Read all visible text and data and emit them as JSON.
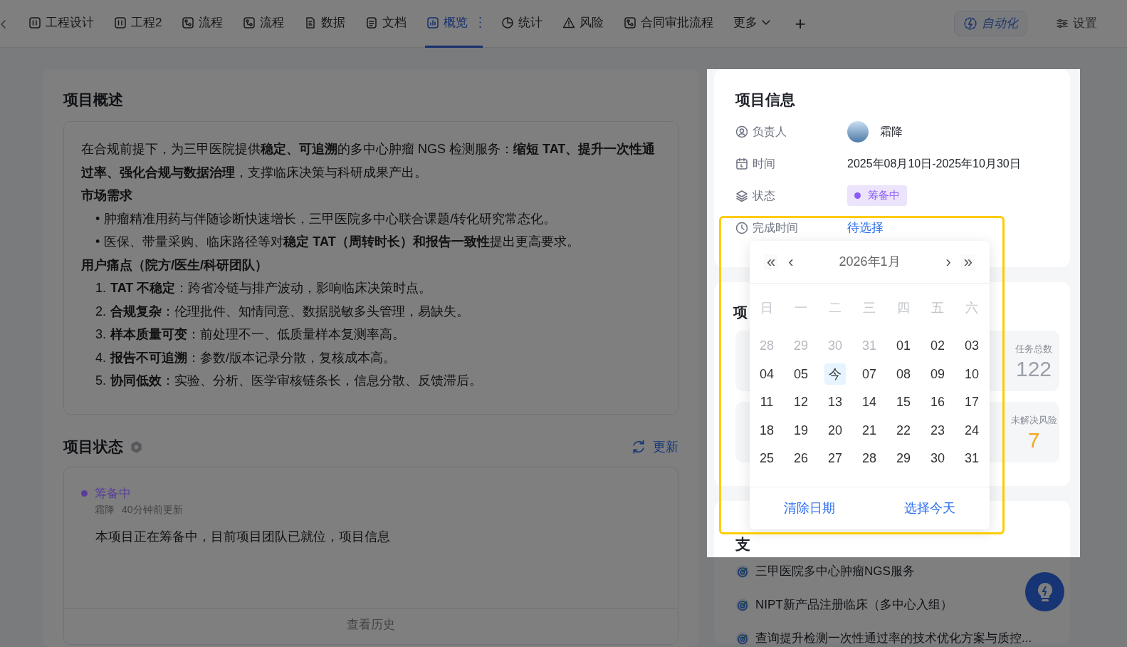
{
  "tabs": [
    {
      "label": "工程设计",
      "kind": "board",
      "selected": false
    },
    {
      "label": "工程2",
      "kind": "board",
      "selected": false
    },
    {
      "label": "流程",
      "kind": "flow",
      "selected": false
    },
    {
      "label": "流程",
      "kind": "flow",
      "selected": false
    },
    {
      "label": "数据",
      "kind": "data",
      "selected": false
    },
    {
      "label": "文档",
      "kind": "doc",
      "selected": false
    },
    {
      "label": "概览",
      "kind": "chart",
      "selected": true
    },
    {
      "label": "统计",
      "kind": "pie",
      "selected": false
    },
    {
      "label": "风险",
      "kind": "warning",
      "selected": false
    },
    {
      "label": "合同审批流程",
      "kind": "flow",
      "selected": false
    }
  ],
  "more_menu": "更多",
  "add_tab": "+",
  "automation_button": "自动化",
  "settings_button": "设置",
  "overview": {
    "title": "项目概述",
    "blocks": [
      {
        "kind": "paragraph",
        "text": "在合规前提下，为三甲医院提供**稳定、可追溯**的多中心肿瘤 NGS 检测服务：**缩短 TAT、提升一次性通过率、强化合规与数据治理**，支撑临床决策与科研成果产出。"
      },
      {
        "kind": "heading",
        "text": "市场需求"
      },
      {
        "kind": "bullet",
        "marker": "•",
        "text": "肿瘤精准用药与伴随诊断快速增长，三甲医院多中心联合课题/转化研究常态化。"
      },
      {
        "kind": "bullet",
        "marker": "•",
        "text": "医保、带量采购、临床路径等对**稳定 TAT（周转时长）和报告一致性**提出更高要求。"
      },
      {
        "kind": "heading",
        "text": "用户痛点（院方/医生/科研团队）"
      },
      {
        "kind": "numbered",
        "marker": "1.",
        "text": "**TAT 不稳定**：跨省冷链与排产波动，影响临床决策时点。"
      },
      {
        "kind": "numbered",
        "marker": "2.",
        "text": "**合规复杂**：伦理批件、知情同意、数据脱敏多头管理，易缺失。"
      },
      {
        "kind": "numbered",
        "marker": "3.",
        "text": "**样本质量可变**：前处理不一、低质量样本复测率高。"
      },
      {
        "kind": "numbered",
        "marker": "4.",
        "text": "**报告不可追溯**：参数/版本记录分散，复核成本高。"
      },
      {
        "kind": "numbered",
        "marker": "5.",
        "text": "**协同低效**：实验、分析、医学审核链条长，信息分散、反馈滞后。"
      }
    ]
  },
  "status": {
    "title": "项目状态",
    "refresh": "更新",
    "entry": {
      "label": "筹备中",
      "color": "#5a3c9a",
      "author": "霜降",
      "time": "40分钟前更新",
      "text": "本项目正在筹备中，目前项目团队已就位，项目信息"
    },
    "history": "查看历史"
  },
  "info": {
    "title": "项目信息",
    "rows": [
      {
        "kind": "owner",
        "label": "负责人",
        "value": "霜降"
      },
      {
        "kind": "text",
        "label": "时间",
        "value": "2025年08月10日-2025年10月30日"
      },
      {
        "kind": "status",
        "label": "状态",
        "value": "筹备中",
        "color": "#8b5cf6"
      },
      {
        "kind": "link",
        "label": "完成时间",
        "value": "待选择"
      }
    ]
  },
  "stats": {
    "title": "项",
    "items": [
      {
        "label": "任务总数",
        "value": "122",
        "color": "#9aa0a8"
      },
      {
        "label": "未解决风险",
        "value": "7",
        "color": "#f5a623"
      }
    ]
  },
  "goals": {
    "title": "支",
    "items": [
      "三甲医院多中心肿瘤NGS服务",
      "NIPT新产品注册临床（多中心入组）",
      "查询提升检测一次性通过率的技术优化方案与质控..."
    ]
  },
  "date_picker": {
    "title": "2026年1月",
    "prev_year": "«",
    "prev_month": "‹",
    "next_month": "›",
    "next_year": "»",
    "weekdays": [
      "日",
      "一",
      "二",
      "三",
      "四",
      "五",
      "六"
    ],
    "days": [
      {
        "text": "28",
        "muted": true,
        "today": false
      },
      {
        "text": "29",
        "muted": true,
        "today": false
      },
      {
        "text": "30",
        "muted": true,
        "today": false
      },
      {
        "text": "31",
        "muted": true,
        "today": false
      },
      {
        "text": "01",
        "muted": false,
        "today": false
      },
      {
        "text": "02",
        "muted": false,
        "today": false
      },
      {
        "text": "03",
        "muted": false,
        "today": false
      },
      {
        "text": "04",
        "muted": false,
        "today": false
      },
      {
        "text": "05",
        "muted": false,
        "today": false
      },
      {
        "text": "今",
        "muted": false,
        "today": true
      },
      {
        "text": "07",
        "muted": false,
        "today": false
      },
      {
        "text": "08",
        "muted": false,
        "today": false
      },
      {
        "text": "09",
        "muted": false,
        "today": false
      },
      {
        "text": "10",
        "muted": false,
        "today": false
      },
      {
        "text": "11",
        "muted": false,
        "today": false
      },
      {
        "text": "12",
        "muted": false,
        "today": false
      },
      {
        "text": "13",
        "muted": false,
        "today": false
      },
      {
        "text": "14",
        "muted": false,
        "today": false
      },
      {
        "text": "15",
        "muted": false,
        "today": false
      },
      {
        "text": "16",
        "muted": false,
        "today": false
      },
      {
        "text": "17",
        "muted": false,
        "today": false
      },
      {
        "text": "18",
        "muted": false,
        "today": false
      },
      {
        "text": "19",
        "muted": false,
        "today": false
      },
      {
        "text": "20",
        "muted": false,
        "today": false
      },
      {
        "text": "21",
        "muted": false,
        "today": false
      },
      {
        "text": "22",
        "muted": false,
        "today": false
      },
      {
        "text": "23",
        "muted": false,
        "today": false
      },
      {
        "text": "24",
        "muted": false,
        "today": false
      },
      {
        "text": "25",
        "muted": false,
        "today": false
      },
      {
        "text": "26",
        "muted": false,
        "today": false
      },
      {
        "text": "27",
        "muted": false,
        "today": false
      },
      {
        "text": "28",
        "muted": false,
        "today": false
      },
      {
        "text": "29",
        "muted": false,
        "today": false
      },
      {
        "text": "30",
        "muted": false,
        "today": false
      },
      {
        "text": "31",
        "muted": false,
        "today": false
      }
    ],
    "buttons": [
      "清除日期",
      "选择今天"
    ]
  }
}
